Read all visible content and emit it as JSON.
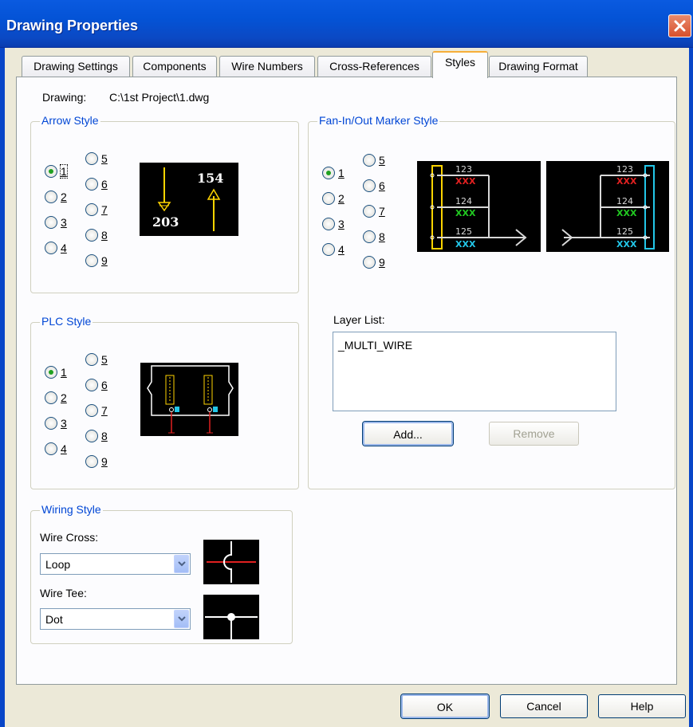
{
  "window": {
    "title": "Drawing Properties"
  },
  "tabs": [
    "Drawing Settings",
    "Components",
    "Wire Numbers",
    "Cross-References",
    "Styles",
    "Drawing Format"
  ],
  "active_tab": "Styles",
  "drawing": {
    "label": "Drawing:",
    "path": "C:\\1st Project\\1.dwg"
  },
  "arrow_style": {
    "title": "Arrow Style",
    "options": [
      "1",
      "2",
      "3",
      "4",
      "5",
      "6",
      "7",
      "8",
      "9"
    ],
    "selected": "1",
    "preview": {
      "label_a": "154",
      "label_b": "203"
    }
  },
  "plc_style": {
    "title": "PLC Style",
    "options": [
      "1",
      "2",
      "3",
      "4",
      "5",
      "6",
      "7",
      "8",
      "9"
    ],
    "selected": "1"
  },
  "fan_style": {
    "title": "Fan-In/Out Marker Style",
    "options": [
      "1",
      "2",
      "3",
      "4",
      "5",
      "6",
      "7",
      "8",
      "9"
    ],
    "selected": "1",
    "preview": {
      "numbers": [
        "123",
        "124",
        "125"
      ],
      "tag": "XXX"
    }
  },
  "layer_list": {
    "label": "Layer List:",
    "items": [
      "_MULTI_WIRE"
    ],
    "add_label": "Add...",
    "remove_label": "Remove"
  },
  "wiring_style": {
    "title": "Wiring Style",
    "wire_cross_label": "Wire Cross:",
    "wire_cross_value": "Loop",
    "wire_tee_label": "Wire Tee:",
    "wire_tee_value": "Dot"
  },
  "buttons": {
    "ok": "OK",
    "cancel": "Cancel",
    "help": "Help"
  },
  "colors": {
    "title_bar": "#0453d6",
    "group_title": "#0046d5",
    "radio_on": "#21a121",
    "preview_bg": "#000000"
  }
}
